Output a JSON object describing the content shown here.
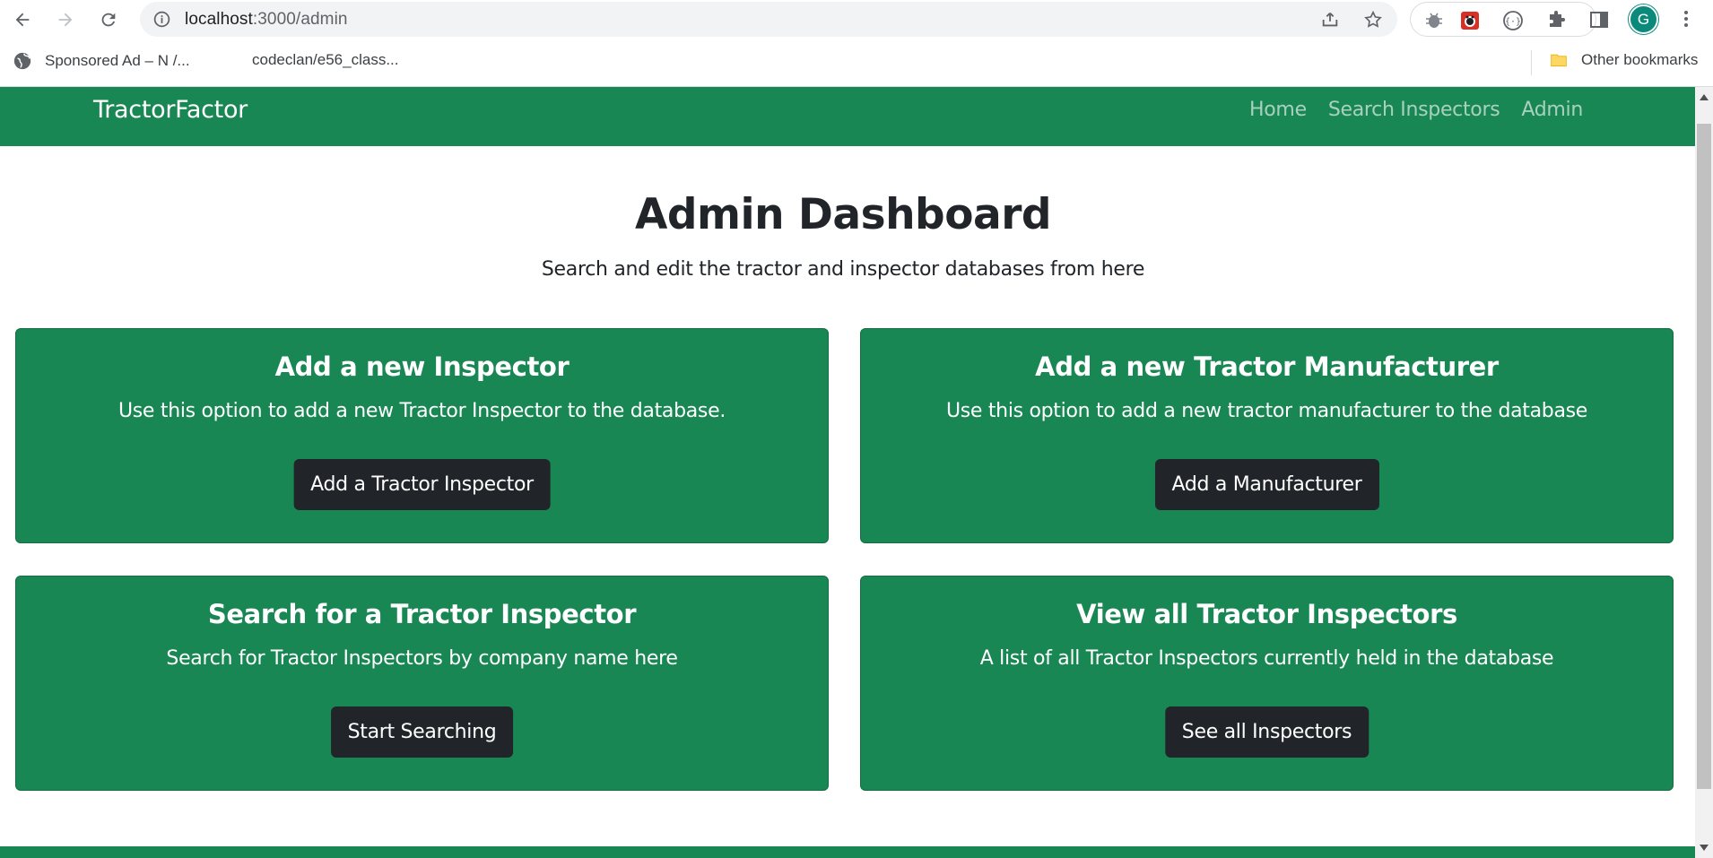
{
  "browser": {
    "url_host": "localhost",
    "url_rest": ":3000/admin",
    "bookmarks": [
      {
        "label": "Sponsored Ad – N /..."
      },
      {
        "label": "codeclan/e56_class..."
      }
    ],
    "other_bookmarks": "Other bookmarks",
    "profile_initial": "G"
  },
  "navbar": {
    "brand": "TractorFactor",
    "links": [
      {
        "label": "Home"
      },
      {
        "label": "Search Inspectors"
      },
      {
        "label": "Admin"
      }
    ]
  },
  "hero": {
    "title": "Admin Dashboard",
    "subtitle": "Search and edit the tractor and inspector databases from here"
  },
  "cards": [
    {
      "title": "Add a new Inspector",
      "text": "Use this option to add a new Tractor Inspector to the database.",
      "button": "Add a Tractor Inspector"
    },
    {
      "title": "Add a new Tractor Manufacturer",
      "text": "Use this option to add a new tractor manufacturer to the database",
      "button": "Add a Manufacturer"
    },
    {
      "title": "Search for a Tractor Inspector",
      "text": "Search for Tractor Inspectors by company name here",
      "button": "Start Searching"
    },
    {
      "title": "View all Tractor Inspectors",
      "text": "A list of all Tractor Inspectors currently held in the database",
      "button": "See all Inspectors"
    }
  ],
  "colors": {
    "navbar_bg": "#198754",
    "card_bg": "#198754",
    "button_bg": "#212529"
  }
}
